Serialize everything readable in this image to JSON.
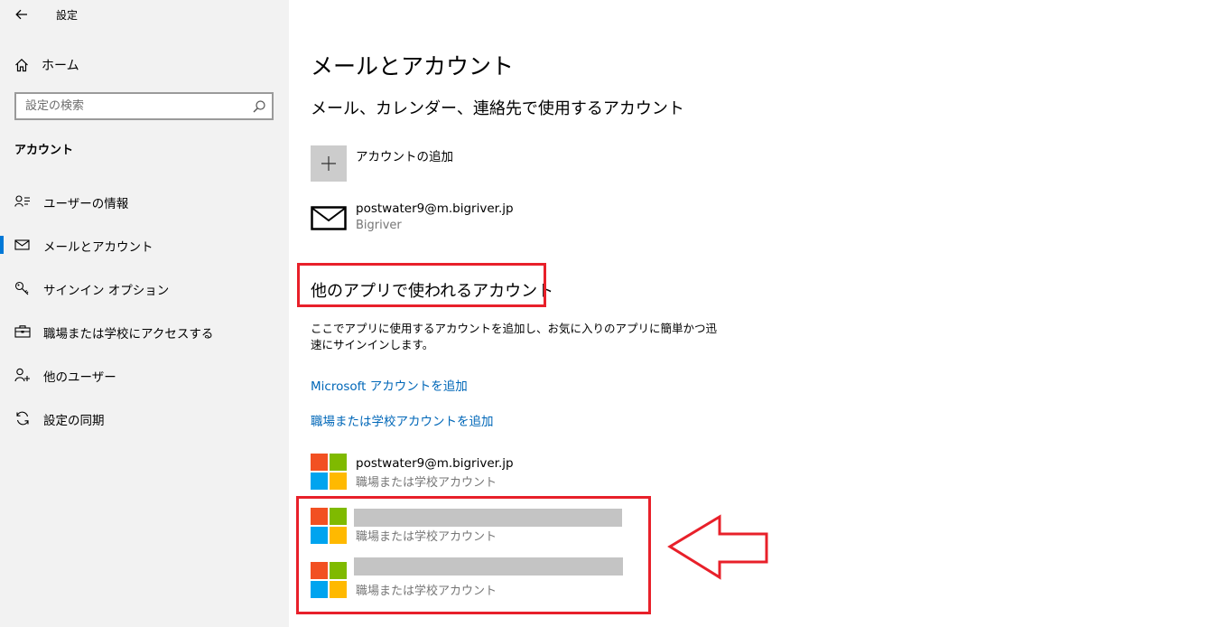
{
  "window": {
    "back_glyph": "←",
    "title": "設定"
  },
  "sidebar": {
    "home_label": "ホーム",
    "search_placeholder": "設定の検索",
    "section": "アカウント",
    "items": [
      {
        "label": "ユーザーの情報",
        "icon": "user-info-icon",
        "active": false
      },
      {
        "label": "メールとアカウント",
        "icon": "mail-icon",
        "active": true
      },
      {
        "label": "サインイン オプション",
        "icon": "key-icon",
        "active": false
      },
      {
        "label": "職場または学校にアクセスする",
        "icon": "briefcase-icon",
        "active": false
      },
      {
        "label": "他のユーザー",
        "icon": "add-user-icon",
        "active": false
      },
      {
        "label": "設定の同期",
        "icon": "sync-icon",
        "active": false
      }
    ]
  },
  "main": {
    "title": "メールとアカウント",
    "email_section_heading": "メール、カレンダー、連絡先で使用するアカウント",
    "add_account_label": "アカウントの追加",
    "email_account": {
      "address": "postwater9@m.bigriver.jp",
      "provider": "Bigriver"
    },
    "other_apps_heading": "他のアプリで使われるアカウント",
    "description": "ここでアプリに使用するアカウントを追加し、お気に入りのアプリに簡単かつ迅速にサインインします。",
    "link_ms": "Microsoft アカウントを追加",
    "link_work": "職場または学校アカウントを追加",
    "accounts": [
      {
        "name": "postwater9@m.bigriver.jp",
        "type": "職場または学校アカウント",
        "redacted": false
      },
      {
        "name": "",
        "type": "職場または学校アカウント",
        "redacted": true
      },
      {
        "name": "",
        "type": "職場または学校アカウント",
        "redacted": true
      }
    ]
  },
  "colors": {
    "accent": "#0078d7",
    "link": "#0067b8",
    "annotation": "#e8202a",
    "ms_red": "#f25022",
    "ms_green": "#7fba00",
    "ms_blue": "#00a4ef",
    "ms_yellow": "#ffb900"
  }
}
